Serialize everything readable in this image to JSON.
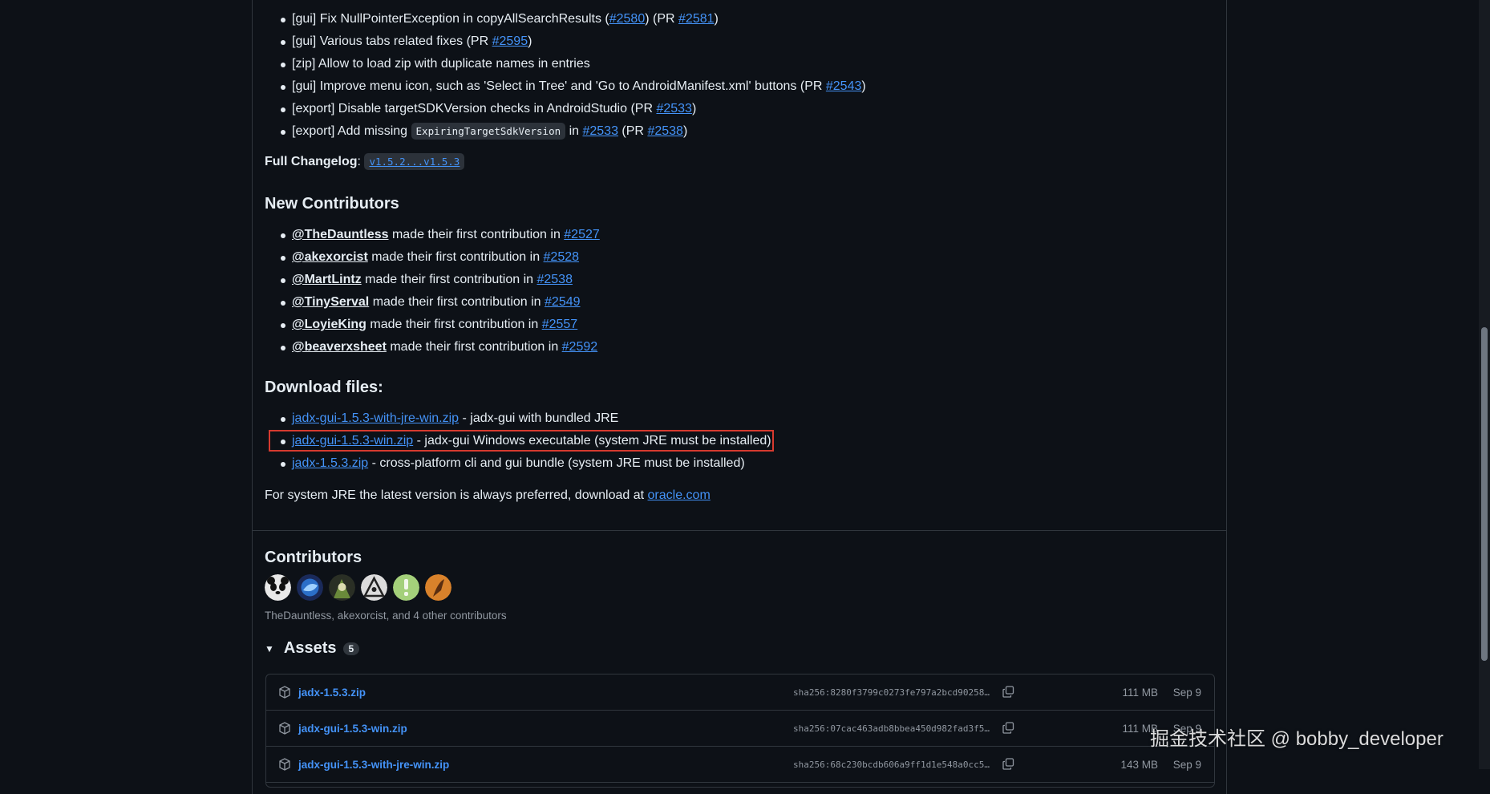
{
  "changes": [
    {
      "prefix": "[gui] Fix NullPointerException in copyAllSearchResults (",
      "link1": "#2580",
      "mid": ") (PR ",
      "link2": "#2581",
      "suffix": ")"
    },
    {
      "prefix": "[gui] Various tabs related fixes (PR ",
      "link1": "#2595",
      "suffix": ")"
    },
    {
      "prefix": "[zip] Allow to load zip with duplicate names in entries"
    },
    {
      "prefix": "[gui] Improve menu icon, such as 'Select in Tree' and 'Go to AndroidManifest.xml' buttons (PR ",
      "link1": "#2543",
      "suffix": ")"
    },
    {
      "prefix": "[export] Disable targetSDKVersion checks in AndroidStudio (PR ",
      "link1": "#2533",
      "suffix": ")"
    },
    {
      "prefix": "[export] Add missing ",
      "code": "ExpiringTargetSdkVersion",
      "mid_after_code": " in ",
      "link1": "#2533",
      "mid": " (PR ",
      "link2": "#2538",
      "suffix": ")"
    }
  ],
  "full_changelog": {
    "label": "Full Changelog",
    "colon": ":",
    "link": "v1.5.2...v1.5.3"
  },
  "new_contributors": {
    "heading": "New Contributors",
    "phrase": " made their first contribution in ",
    "items": [
      {
        "user": "@TheDauntless",
        "pr": "#2527"
      },
      {
        "user": "@akexorcist",
        "pr": "#2528"
      },
      {
        "user": "@MartLintz",
        "pr": "#2538"
      },
      {
        "user": "@TinyServal",
        "pr": "#2549"
      },
      {
        "user": "@LoyieKing",
        "pr": "#2557"
      },
      {
        "user": "@beaverxsheet",
        "pr": "#2592"
      }
    ]
  },
  "download": {
    "heading": "Download files:",
    "items": [
      {
        "file": "jadx-gui-1.5.3-with-jre-win.zip",
        "desc": " - jadx-gui with bundled JRE"
      },
      {
        "file": "jadx-gui-1.5.3-win.zip",
        "desc": " - jadx-gui Windows executable (system JRE must be installed)"
      },
      {
        "file": "jadx-1.5.3.zip",
        "desc": " - cross-platform cli and gui bundle (system JRE must be installed)"
      }
    ],
    "jre_note": "For system JRE the latest version is always preferred, download at ",
    "jre_link": "oracle.com"
  },
  "contributors": {
    "heading": "Contributors",
    "summary": "TheDauntless, akexorcist, and 4 other contributors",
    "avatar_colors": [
      "#e8e8e8",
      "#2b6fc9",
      "#6a8a3a",
      "#dcdcdc",
      "#a4d07a",
      "#d9822b"
    ]
  },
  "assets": {
    "heading": "Assets",
    "count": "5",
    "rows": [
      {
        "name": "jadx-1.5.3.zip",
        "sha": "sha256:8280f3799c0273fe797a2bcd90258…",
        "size": "111 MB",
        "date": "Sep 9"
      },
      {
        "name": "jadx-gui-1.5.3-win.zip",
        "sha": "sha256:07cac463adb8bbea450d982fad3f5…",
        "size": "111 MB",
        "date": "Sep 9"
      },
      {
        "name": "jadx-gui-1.5.3-with-jre-win.zip",
        "sha": "sha256:68c230bcdb606a9ff1d1e548a0cc5…",
        "size": "143 MB",
        "date": "Sep 9"
      }
    ]
  },
  "watermark": "掘金技术社区 @ bobby_developer"
}
